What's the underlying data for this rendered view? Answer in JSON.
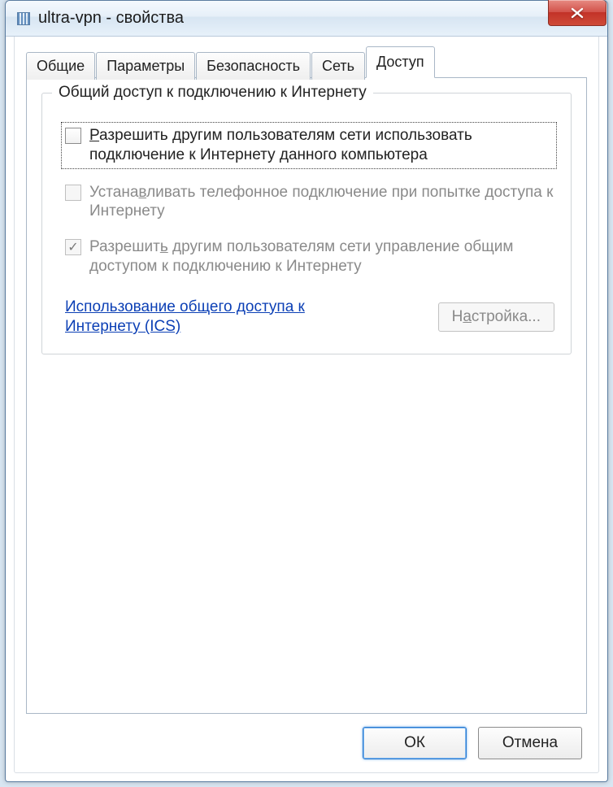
{
  "window": {
    "title": "ultra-vpn - свойства"
  },
  "tabs": {
    "items": [
      {
        "label": "Общие"
      },
      {
        "label": "Параметры"
      },
      {
        "label": "Безопасность"
      },
      {
        "label": "Сеть"
      },
      {
        "label": "Доступ",
        "active": true
      }
    ]
  },
  "group": {
    "title": "Общий доступ к подключению к Интернету",
    "checkbox1": {
      "checked": false,
      "enabled": true,
      "focused": true,
      "label_pre": "",
      "label_u": "Р",
      "label_post": "азрешить другим пользователям сети использовать подключение к Интернету данного компьютера"
    },
    "checkbox2": {
      "checked": false,
      "enabled": false,
      "label_pre": "Устана",
      "label_u": "в",
      "label_post": "ливать телефонное подключение при попытке доступа к Интернету"
    },
    "checkbox3": {
      "checked": true,
      "enabled": false,
      "label_pre": "Разрешит",
      "label_u": "ь",
      "label_post": " другим пользователям сети управление общим доступом к подключению к Интернету"
    },
    "link": "Использование общего доступа к Интернету (ICS)",
    "settings_button_pre": "Н",
    "settings_button_u": "а",
    "settings_button_post": "стройка..."
  },
  "footer": {
    "ok": "ОК",
    "cancel": "Отмена"
  }
}
